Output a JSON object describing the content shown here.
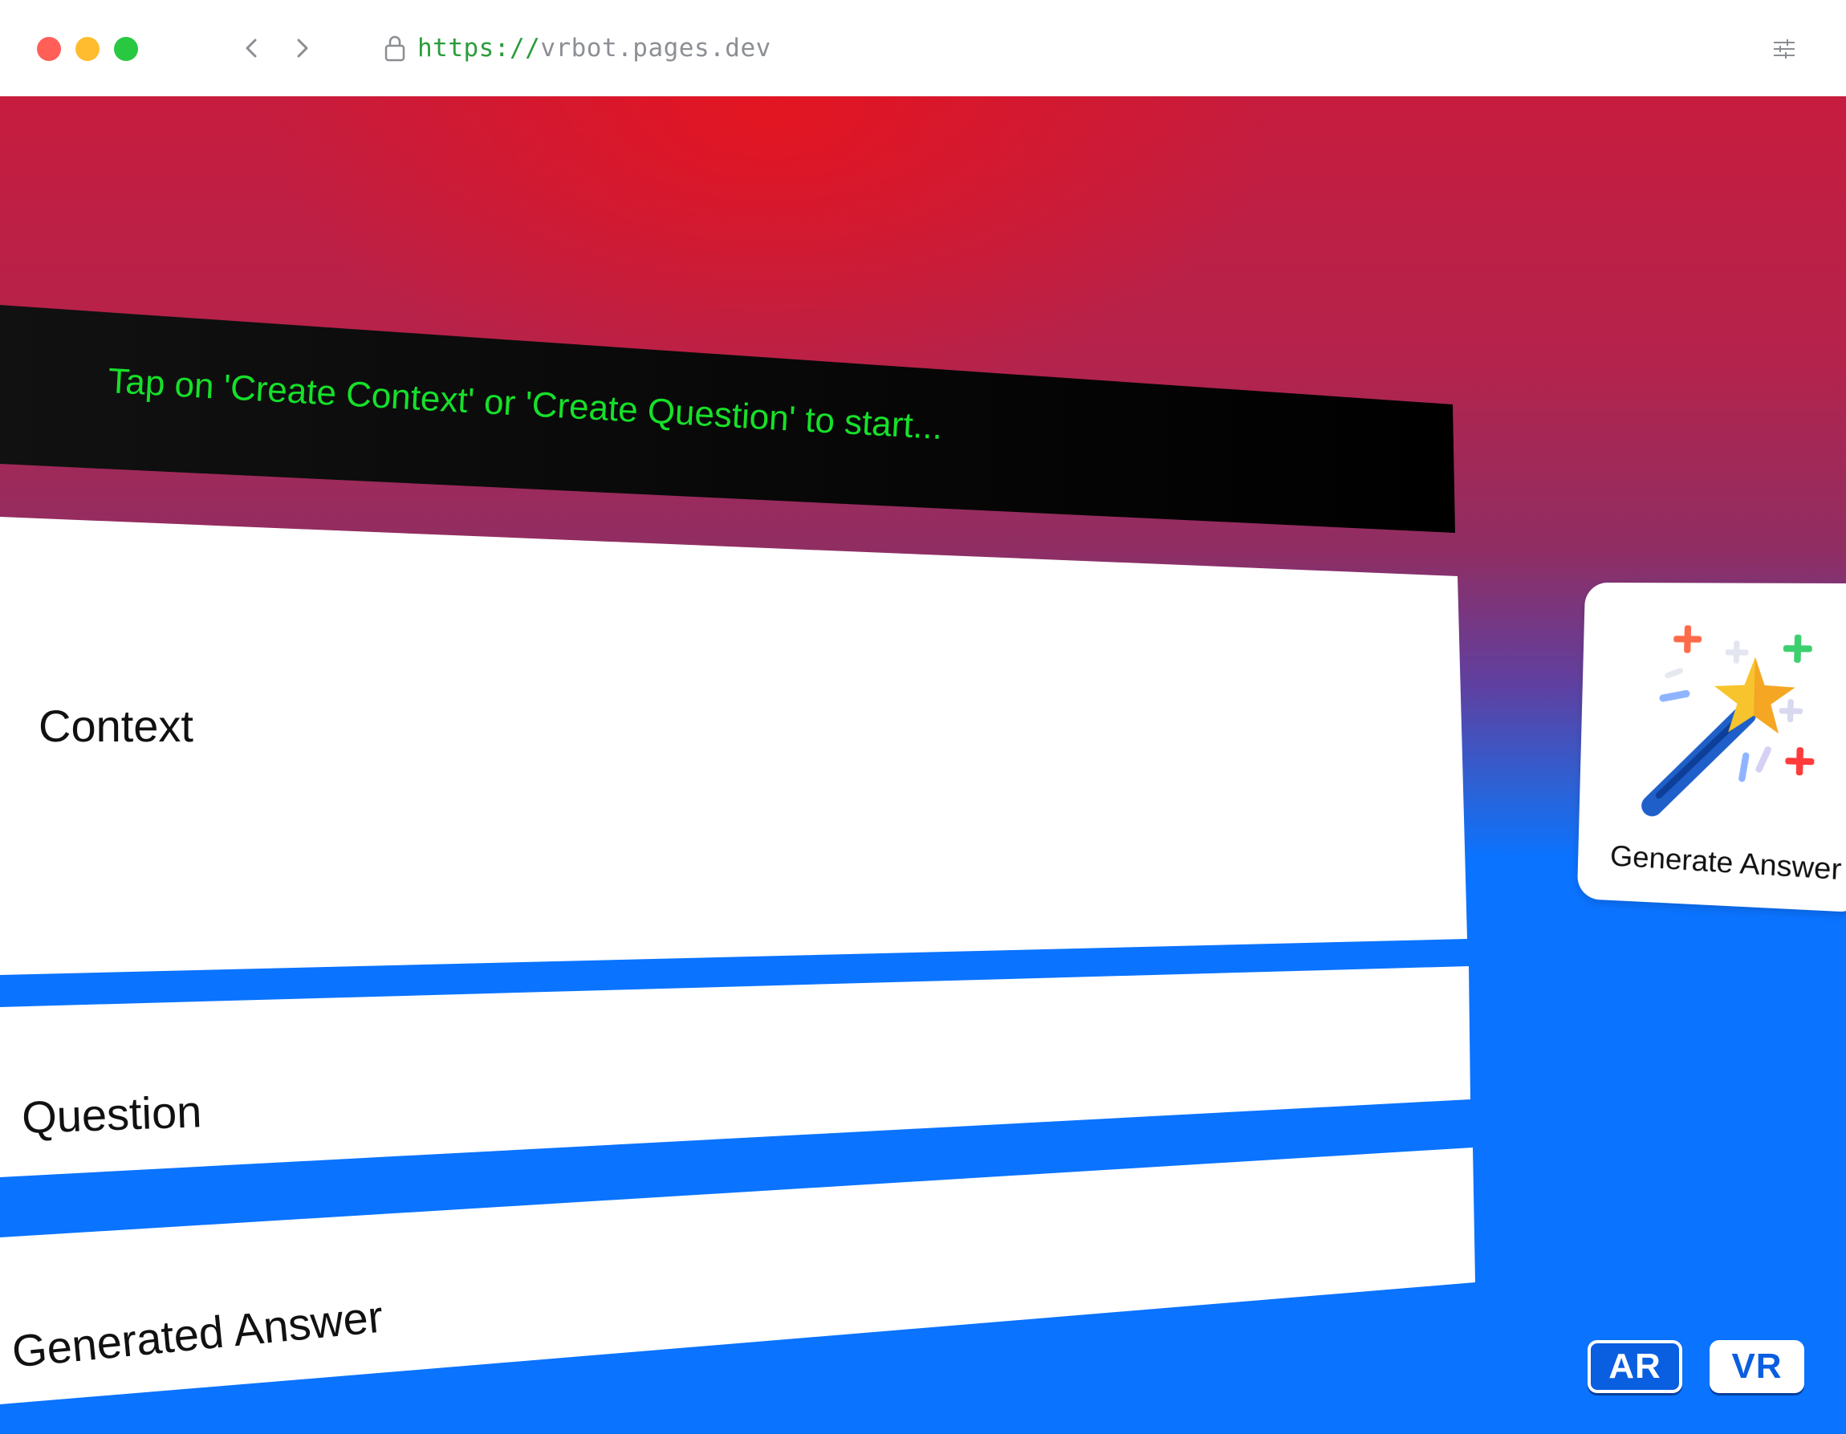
{
  "browser": {
    "url_protocol": "https://",
    "url_host": "vrbot.pages.dev"
  },
  "scene": {
    "status_message": "Tap on 'Create Context' or 'Create Question' to start...",
    "panels": {
      "context_label": "Context",
      "question_label": "Question",
      "answer_label": "Generated Answer"
    },
    "generate_button_label": "Generate Answer",
    "mode_buttons": {
      "ar": "AR",
      "vr": "VR"
    }
  },
  "colors": {
    "status_text": "#16e02a",
    "blue_floor": "#0a73ff",
    "red_sky": "#d8172a"
  },
  "icons": [
    "lock-icon",
    "back-arrow-icon",
    "forward-arrow-icon",
    "settings-sliders-icon",
    "magic-wand-icon"
  ]
}
